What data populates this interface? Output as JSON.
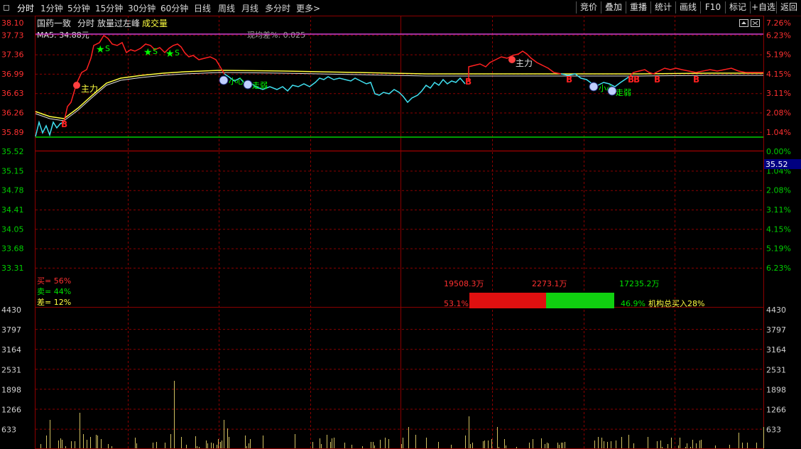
{
  "toolbar": {
    "menu_icon": "◻",
    "tabs": [
      "分时",
      "1分钟",
      "5分钟",
      "15分钟",
      "30分钟",
      "60分钟",
      "日线",
      "周线",
      "月线",
      "多分时",
      "更多>"
    ],
    "right_buttons": [
      "竞价",
      "叠加",
      "重播",
      "统计",
      "画线",
      "F10",
      "标记",
      "+自选",
      "返回"
    ]
  },
  "header": {
    "stock_name": "国药一致",
    "period": "分时",
    "indicator": "放量过左峰",
    "volume_label": "成交量",
    "ma_label": "MA5: 34.88元",
    "diff_label": "现均差%: 0.025"
  },
  "price_axis_left": [
    "38.10",
    "37.73",
    "37.36",
    "36.99",
    "36.63",
    "36.26",
    "35.89",
    "35.52",
    "35.15",
    "34.78",
    "34.41",
    "34.05",
    "33.68",
    "33.31"
  ],
  "price_axis_right": [
    "7.26%",
    "6.23%",
    "5.19%",
    "4.15%",
    "3.11%",
    "2.08%",
    "1.04%",
    "0.00%",
    "1.04%",
    "2.08%",
    "3.11%",
    "4.15%",
    "5.19%",
    "6.23%"
  ],
  "current_price_tag": "35.52",
  "volume_axis": [
    "4430",
    "3797",
    "3164",
    "2531",
    "1898",
    "1266",
    "633"
  ],
  "signals": {
    "main_force": "主力",
    "weak": "走弱",
    "careful": "小心",
    "sell": "S",
    "buy": "B"
  },
  "ratio_panel": {
    "buy": "买= 56%",
    "sell": "卖= 44%",
    "diff": "差= 12%"
  },
  "flow_bar": {
    "left_amount": "19508.3万",
    "mid_amount": "2273.1万",
    "right_amount": "17235.2万",
    "left_pct": "53.1%",
    "right_pct": "46.9%",
    "note": "机构总买入28%",
    "buy_fraction": 0.531
  },
  "colors": {
    "up": "#ff2020",
    "down": "#00d000",
    "price_line_low": "#40e0f0",
    "avg_line": "#ffff40",
    "ma_line": "#d040d0",
    "grid": "#8b0000"
  }
}
